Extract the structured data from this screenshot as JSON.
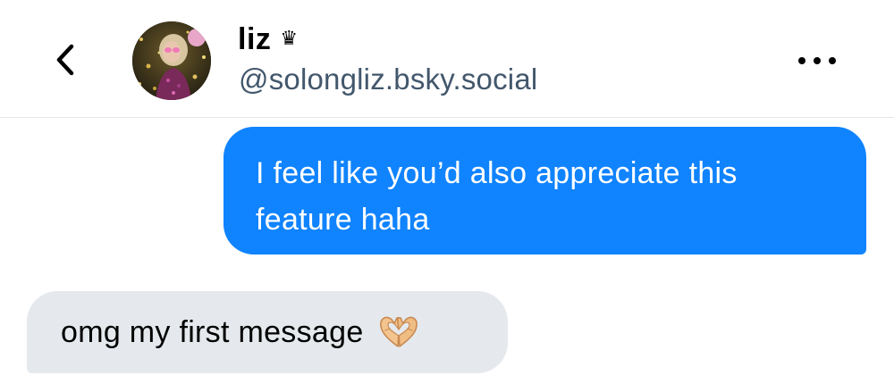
{
  "header": {
    "back_icon": "chevron-left-icon",
    "avatar_icon": "user-avatar-photo",
    "display_name": "liz",
    "badge_icon": "crown-icon",
    "badge_glyph": "♛",
    "handle": "@solongliz.bsky.social",
    "more_icon": "more-horizontal-icon"
  },
  "messages": [
    {
      "direction": "outgoing",
      "text": "I feel like you’d also appreciate this feature haha",
      "bubble_color": "#1083fe",
      "text_color": "#ffffff"
    },
    {
      "direction": "incoming",
      "text": "omg my first message",
      "emoji_icon": "heart-hands-emoji-icon",
      "bubble_color": "#e5e9ed",
      "text_color": "#000000"
    }
  ],
  "colors": {
    "handle": "#42576c",
    "divider": "#e3e5e8",
    "background": "#ffffff"
  }
}
